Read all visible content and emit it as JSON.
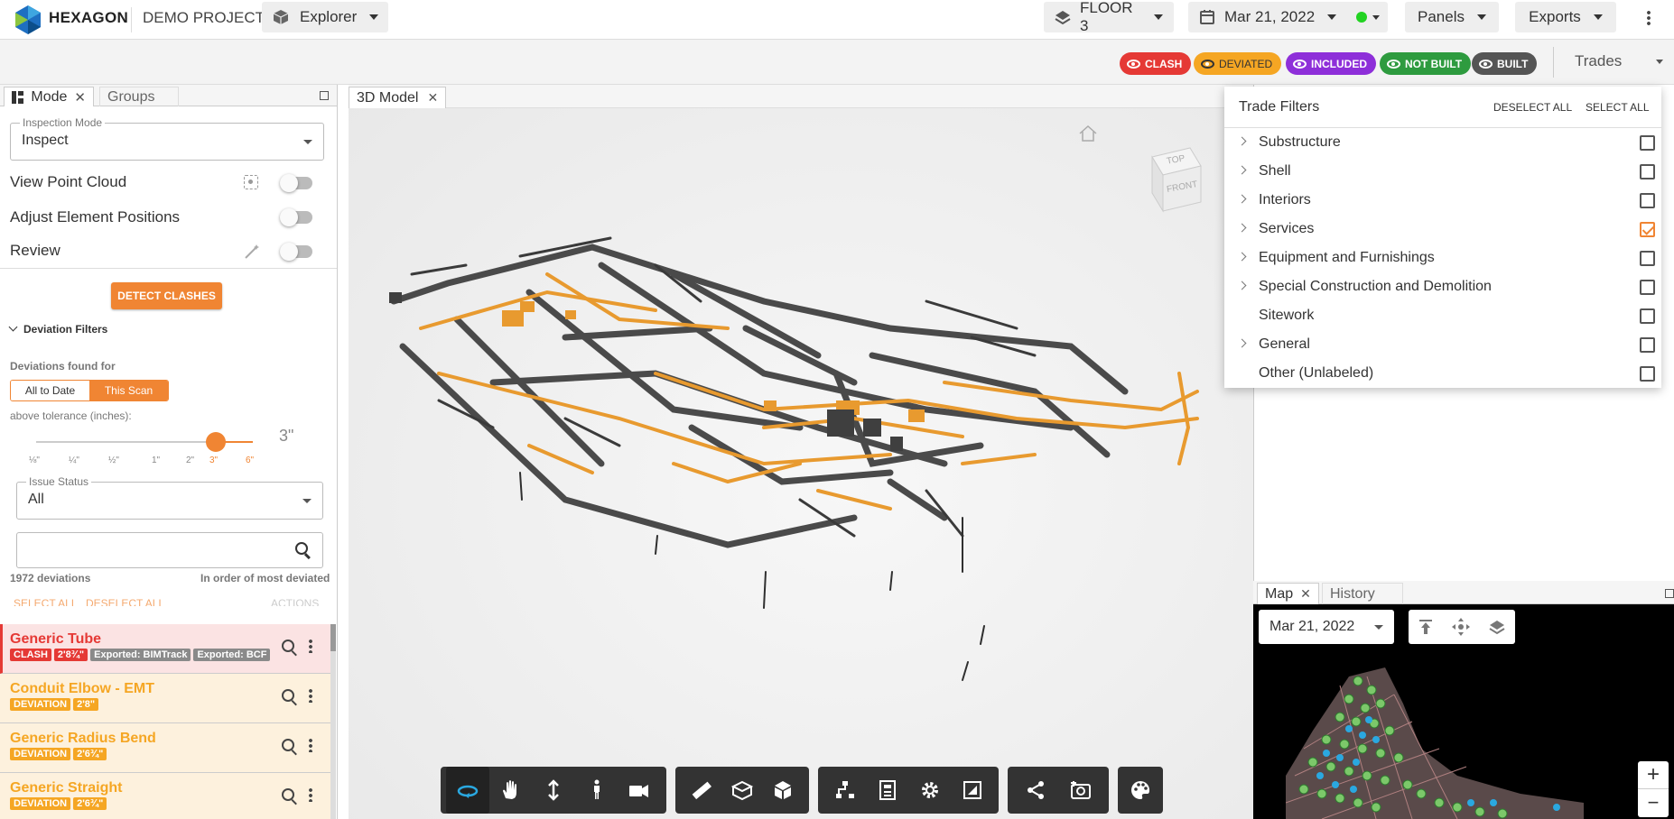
{
  "topbar": {
    "brand": "HEXAGON",
    "project": "DEMO PROJECT",
    "explorer_label": "Explorer",
    "floor_label": "FLOOR 3",
    "date_label": "Mar 21, 2022",
    "status_color": "#22d322",
    "panels_label": "Panels",
    "exports_label": "Exports"
  },
  "status_chips": [
    {
      "label": "CLASH",
      "color": "#e53935"
    },
    {
      "label": "DEVIATED",
      "color": "#f5a623"
    },
    {
      "label": "INCLUDED",
      "color": "#8e2fd9"
    },
    {
      "label": "NOT BUILT",
      "color": "#2e9b3f"
    },
    {
      "label": "BUILT",
      "color": "#555555"
    }
  ],
  "trades_label": "Trades",
  "left": {
    "tab_mode": "Mode",
    "tab_groups": "Groups",
    "inspection_mode_label": "Inspection Mode",
    "inspection_mode_value": "Inspect",
    "view_point_cloud": "View Point Cloud",
    "adjust_positions": "Adjust Element Positions",
    "review": "Review",
    "detect_clashes": "DETECT CLASHES",
    "deviation_filters": "Deviation Filters",
    "deviations_found_for": "Deviations found for",
    "seg_all": "All to Date",
    "seg_scan": "This Scan",
    "above_tolerance": "above tolerance (inches):",
    "ticks": [
      "⅛\"",
      "¼\"",
      "½\"",
      "1\"",
      "2\"",
      "3\"",
      "6\""
    ],
    "tolerance_value_pos": 5,
    "tolerance_display": "3\"",
    "issue_status_label": "Issue Status",
    "issue_status_value": "All",
    "search_placeholder": "",
    "deviation_count": "1972 deviations",
    "order": "In order of most deviated",
    "select_all": "SELECT ALL",
    "deselect_all": "DESELECT ALL",
    "actions": "ACTIONS",
    "deviations": [
      {
        "name": "Generic Tube",
        "type": "clash",
        "tags": [
          {
            "t": "CLASH",
            "c": "#e53935"
          },
          {
            "t": "2'8¾\"",
            "c": "#e53935"
          },
          {
            "t": "Exported: BIMTrack",
            "c": "#8a8a8a"
          },
          {
            "t": "Exported: BCF",
            "c": "#8a8a8a"
          }
        ]
      },
      {
        "name": "Conduit Elbow - EMT",
        "type": "dev",
        "tags": [
          {
            "t": "DEVIATION",
            "c": "#f5a623"
          },
          {
            "t": "2'8\"",
            "c": "#f5a623"
          }
        ]
      },
      {
        "name": "Generic Radius Bend",
        "type": "dev",
        "tags": [
          {
            "t": "DEVIATION",
            "c": "#f5a623"
          },
          {
            "t": "2'6¾\"",
            "c": "#f5a623"
          }
        ]
      },
      {
        "name": "Generic Straight",
        "type": "dev",
        "tags": [
          {
            "t": "DEVIATION",
            "c": "#f5a623"
          },
          {
            "t": "2'6¾\"",
            "c": "#f5a623"
          }
        ]
      }
    ]
  },
  "viewport": {
    "tab": "3D Model",
    "cube_top": "TOP",
    "cube_front": "FRONT"
  },
  "trade_filters": {
    "title": "Trade Filters",
    "deselect_all": "DESELECT ALL",
    "select_all": "SELECT ALL",
    "items": [
      {
        "name": "Substructure",
        "expandable": true,
        "checked": false
      },
      {
        "name": "Shell",
        "expandable": true,
        "checked": false
      },
      {
        "name": "Interiors",
        "expandable": true,
        "checked": false
      },
      {
        "name": "Services",
        "expandable": true,
        "checked": true
      },
      {
        "name": "Equipment and Furnishings",
        "expandable": true,
        "checked": false
      },
      {
        "name": "Special Construction and Demolition",
        "expandable": true,
        "checked": false
      },
      {
        "name": "Sitework",
        "expandable": false,
        "checked": false
      },
      {
        "name": "General",
        "expandable": true,
        "checked": false
      },
      {
        "name": "Other (Unlabeled)",
        "expandable": false,
        "checked": false
      }
    ]
  },
  "map": {
    "tab_map": "Map",
    "tab_history": "History",
    "date": "Mar 21, 2022",
    "zoom_in": "+",
    "zoom_out": "−"
  },
  "colors": {
    "accent": "#f08533",
    "clash": "#e53935",
    "deviation": "#f5a623"
  }
}
